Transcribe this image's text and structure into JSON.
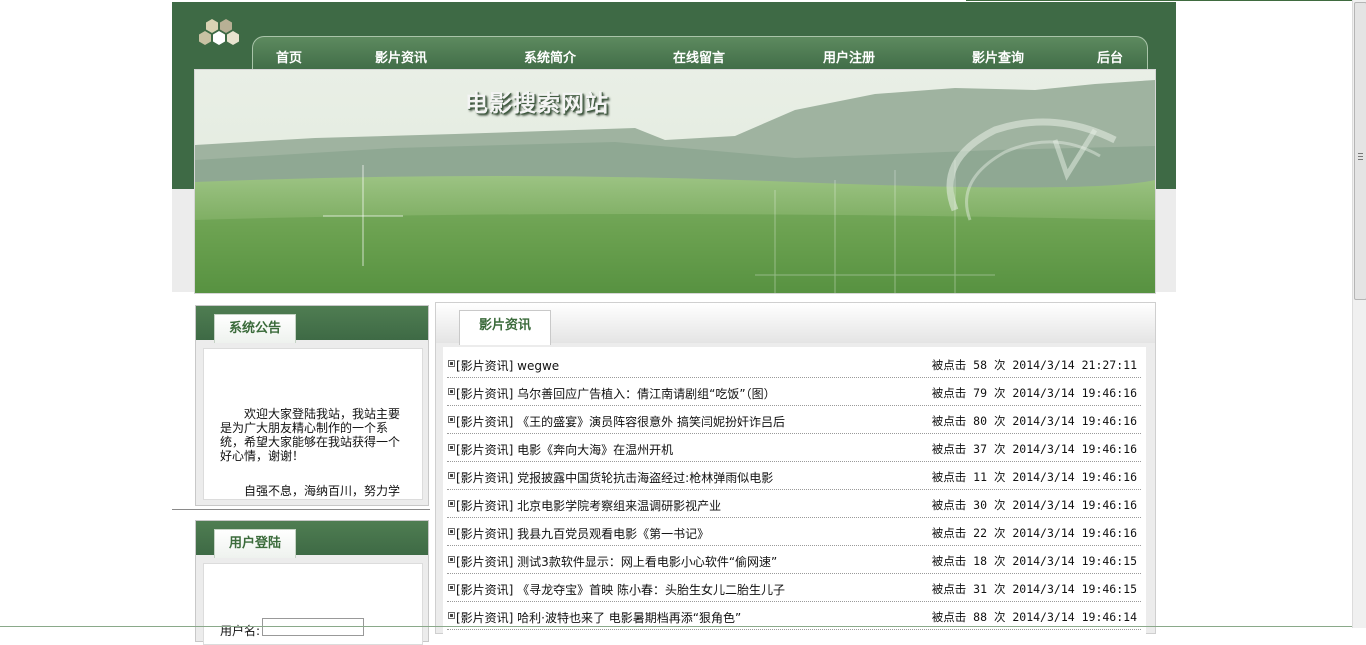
{
  "site": {
    "banner_title": "电影搜索网站"
  },
  "nav": {
    "items": [
      {
        "label": "首页"
      },
      {
        "label": "影片资讯"
      },
      {
        "label": "系统简介"
      },
      {
        "label": "在线留言"
      },
      {
        "label": "用户注册"
      },
      {
        "label": "影片查询"
      },
      {
        "label": "后台"
      }
    ]
  },
  "notice": {
    "title": "系统公告",
    "text": "欢迎大家登陆我站，我站主要是为广大朋友精心制作的一个系统，希望大家能够在我站获得一个好心情，谢谢！",
    "motto": "自强不息，海纳百川，努力学"
  },
  "login": {
    "title": "用户登陆",
    "username_label": "用户名:",
    "username_value": ""
  },
  "news": {
    "tab": "影片资讯",
    "items": [
      {
        "title": "[影片资讯] wegwe",
        "meta": "被点击 58 次 2014/3/14 21:27:11"
      },
      {
        "title": "[影片资讯] 乌尔善回应广告植入：倩江南请剧组“吃饭”（图）",
        "meta": "被点击 79 次 2014/3/14 19:46:16"
      },
      {
        "title": "[影片资讯] 《王的盛宴》演员阵容很意外 搞笑闫妮扮奸诈吕后",
        "meta": "被点击 80 次 2014/3/14 19:46:16"
      },
      {
        "title": "[影片资讯] 电影《奔向大海》在温州开机",
        "meta": "被点击 37 次 2014/3/14 19:46:16"
      },
      {
        "title": "[影片资讯] 党报披露中国货轮抗击海盗经过:枪林弹雨似电影",
        "meta": "被点击 11 次 2014/3/14 19:46:16"
      },
      {
        "title": "[影片资讯] 北京电影学院考察组来温调研影视产业",
        "meta": "被点击 30 次 2014/3/14 19:46:16"
      },
      {
        "title": "[影片资讯] 我县九百党员观看电影《第一书记》",
        "meta": "被点击 22 次 2014/3/14 19:46:16"
      },
      {
        "title": "[影片资讯] 测试3款软件显示：网上看电影小心软件“偷网速”",
        "meta": "被点击 18 次 2014/3/14 19:46:15"
      },
      {
        "title": "[影片资讯] 《寻龙夺宝》首映 陈小春：头胎生女儿二胎生儿子",
        "meta": "被点击 31 次 2014/3/14 19:46:15"
      },
      {
        "title": "[影片资讯] 哈利·波特也来了 电影暑期档再添“狠角色”",
        "meta": "被点击 88 次 2014/3/14 19:46:14"
      }
    ]
  }
}
